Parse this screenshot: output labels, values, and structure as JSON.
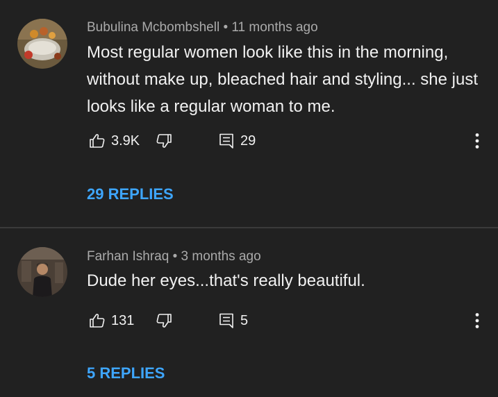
{
  "comments": [
    {
      "author": "Bubulina Mcbombshell",
      "separator": "•",
      "time": "11 months ago",
      "text": "Most regular women look like this in the morning, without make up, bleached hair and styling... she just looks like a regular woman to me.",
      "likes": "3.9K",
      "reply_count": "29",
      "replies_label": "29 REPLIES",
      "avatar_icon": "avatar-photo-food",
      "like_icon": "thumbs-up-icon",
      "dislike_icon": "thumbs-down-icon",
      "reply_icon": "reply-icon",
      "more_icon": "more-vert-icon"
    },
    {
      "author": "Farhan Ishraq",
      "separator": "•",
      "time": "3 months ago",
      "text": "Dude her eyes...that's really beautiful.",
      "likes": "131",
      "reply_count": "5",
      "replies_label": "5 REPLIES",
      "avatar_icon": "avatar-photo-person",
      "like_icon": "thumbs-up-icon",
      "dislike_icon": "thumbs-down-icon",
      "reply_icon": "reply-icon",
      "more_icon": "more-vert-icon"
    }
  ],
  "colors": {
    "background": "#212121",
    "primary_text": "#f1f1f1",
    "secondary_text": "#aaaaaa",
    "link": "#3ea6ff",
    "divider": "#3a3a3a"
  }
}
